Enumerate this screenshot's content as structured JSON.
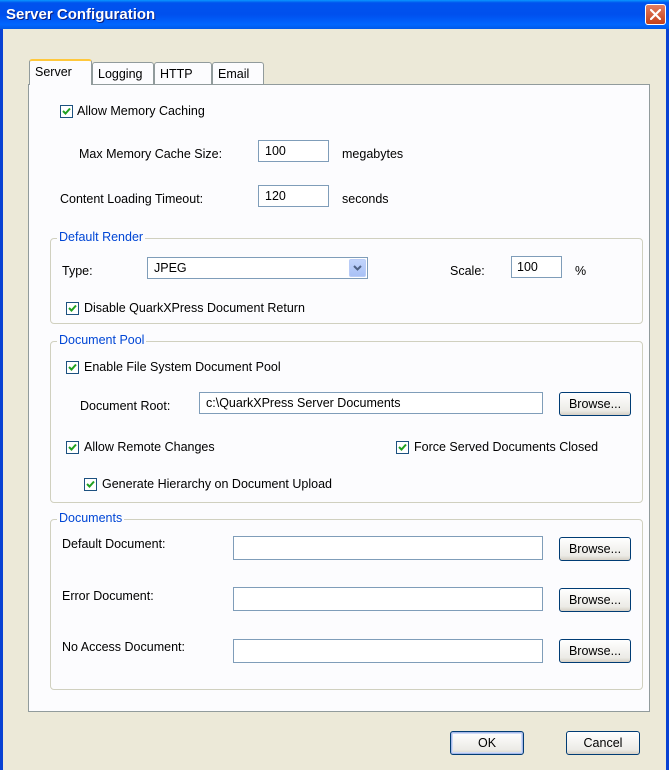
{
  "window": {
    "title": "Server Configuration"
  },
  "tabs": [
    {
      "label": "Server",
      "active": true
    },
    {
      "label": "Logging",
      "active": false
    },
    {
      "label": "HTTP",
      "active": false
    },
    {
      "label": "Email",
      "active": false
    }
  ],
  "server": {
    "allow_memory_caching": {
      "label": "Allow Memory Caching",
      "checked": true
    },
    "max_memory_cache": {
      "label": "Max Memory Cache Size:",
      "value": "100",
      "unit": "megabytes"
    },
    "content_loading_timeout": {
      "label": "Content Loading Timeout:",
      "value": "120",
      "unit": "seconds"
    },
    "default_render": {
      "legend": "Default Render",
      "type_label": "Type:",
      "type_value": "JPEG",
      "scale_label": "Scale:",
      "scale_value": "100",
      "scale_unit": "%",
      "disable_return": {
        "label": "Disable QuarkXPress Document Return",
        "checked": true
      }
    },
    "document_pool": {
      "legend": "Document Pool",
      "enable_pool": {
        "label": "Enable File System Document Pool",
        "checked": true
      },
      "root_label": "Document Root:",
      "root_value": "c:\\QuarkXPress Server Documents",
      "browse_label": "Browse...",
      "allow_remote_changes": {
        "label": "Allow Remote Changes",
        "checked": true
      },
      "force_closed": {
        "label": "Force Served Documents Closed",
        "checked": true
      },
      "generate_hierarchy": {
        "label": "Generate Hierarchy on Document Upload",
        "checked": true
      }
    },
    "documents": {
      "legend": "Documents",
      "default_doc": {
        "label": "Default Document:",
        "value": "",
        "browse_label": "Browse..."
      },
      "error_doc": {
        "label": "Error Document:",
        "value": "",
        "browse_label": "Browse..."
      },
      "no_access_doc": {
        "label": "No Access Document:",
        "value": "",
        "browse_label": "Browse..."
      }
    }
  },
  "footer": {
    "ok_label": "OK",
    "cancel_label": "Cancel"
  }
}
